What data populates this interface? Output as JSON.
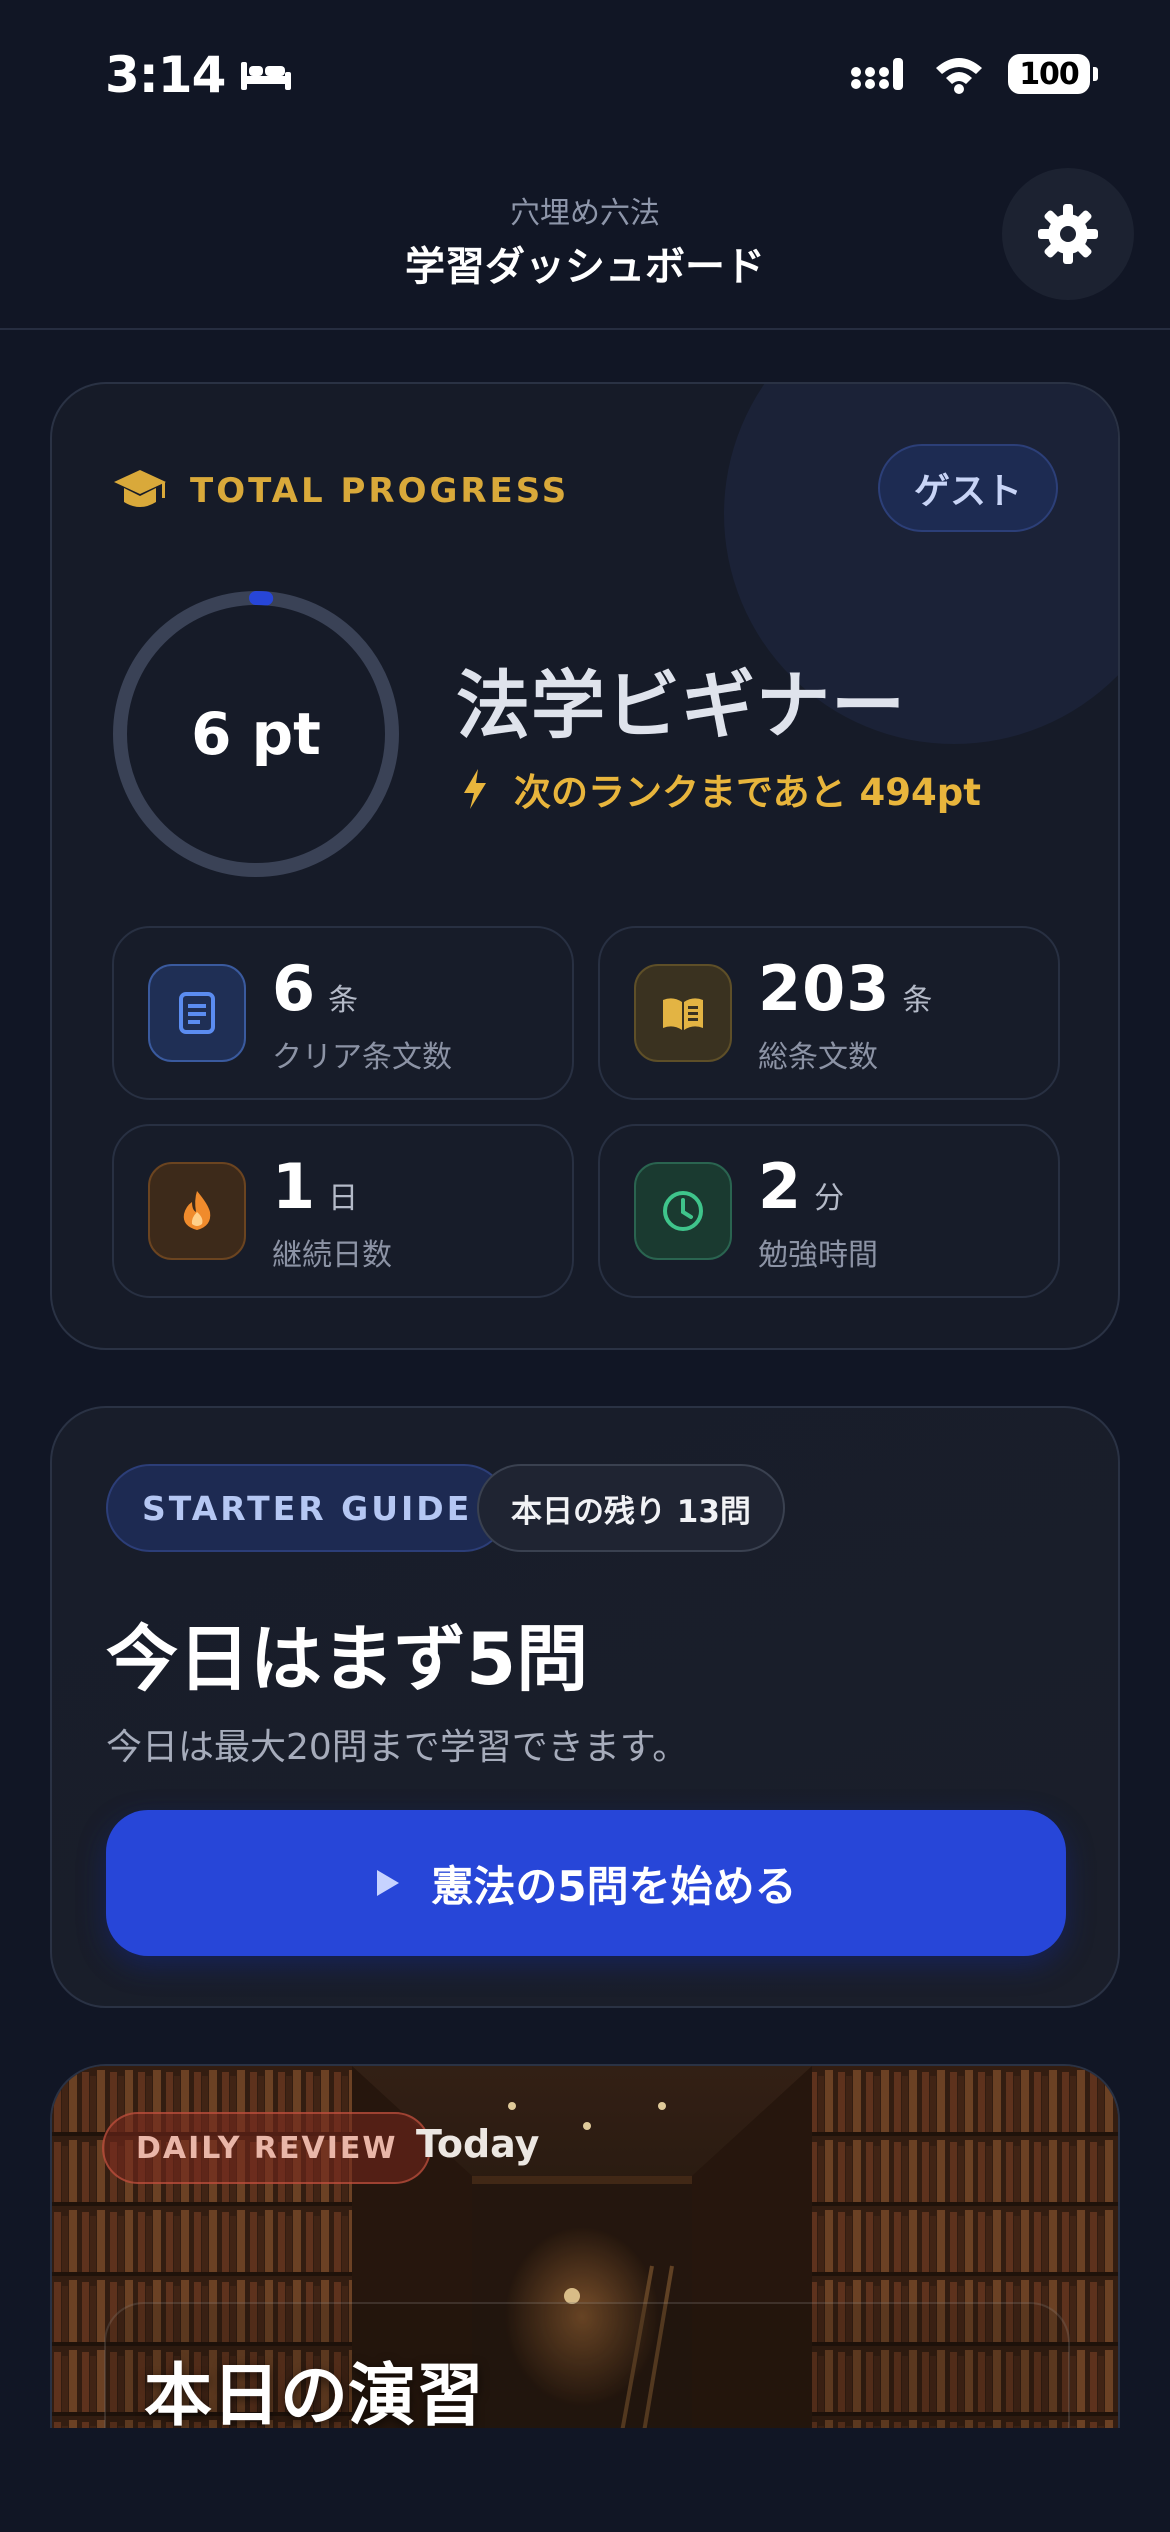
{
  "status_bar": {
    "time": "3:14",
    "battery": "100"
  },
  "header": {
    "app_name": "穴埋め六法",
    "title": "学習ダッシュボード"
  },
  "progress_card": {
    "label": "TOTAL PROGRESS",
    "user_badge": "ゲスト",
    "points": "6 pt",
    "points_progress_fraction": 0.012,
    "rank": "法学ビギナー",
    "next_rank_text": "次のランクまであと 494pt",
    "stats": [
      {
        "value": "6",
        "unit": "条",
        "label": "クリア条文数",
        "icon": "document-icon",
        "color": "#5b8cf0"
      },
      {
        "value": "203",
        "unit": "条",
        "label": "総条文数",
        "icon": "book-icon",
        "color": "#e3b443"
      },
      {
        "value": "1",
        "unit": "日",
        "label": "継続日数",
        "icon": "flame-icon",
        "color": "#f08b2c"
      },
      {
        "value": "2",
        "unit": "分",
        "label": "勉強時間",
        "icon": "clock-icon",
        "color": "#3fc48b"
      }
    ]
  },
  "starter_card": {
    "badge": "STARTER GUIDE",
    "remaining": "本日の残り 13問",
    "title": "今日はまず5問",
    "description": "今日は最大20問まで学習できます。",
    "button_label": "憲法の5問を始める"
  },
  "daily_card": {
    "badge": "DAILY REVIEW",
    "subtitle": "Today",
    "title": "本日の演習"
  },
  "colors": {
    "background": "#111625",
    "accent_blue": "#2746d8",
    "gold": "#d9a93a"
  }
}
